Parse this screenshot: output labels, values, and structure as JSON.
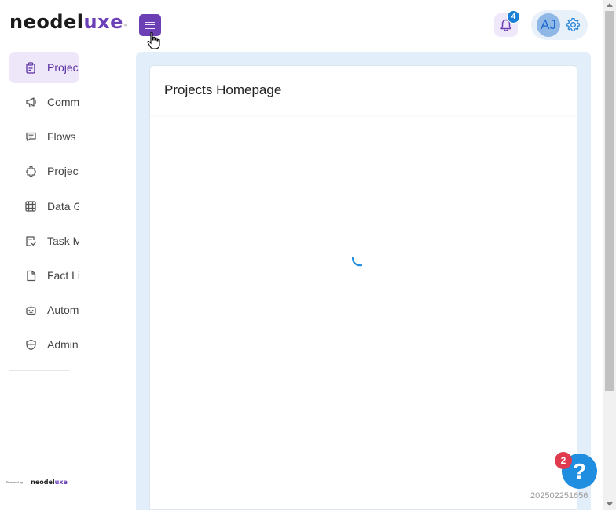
{
  "header": {
    "logo_main": "neodel",
    "logo_accent": "uxe",
    "logo_tm": "™",
    "notifications_count": "4",
    "avatar_initials": "AJ"
  },
  "sidebar": {
    "items": [
      {
        "label": "Projects",
        "icon": "clipboard-icon",
        "active": true
      },
      {
        "label": "Communications",
        "icon": "megaphone-icon"
      },
      {
        "label": "Flows",
        "icon": "chat-icon"
      },
      {
        "label": "Projects",
        "icon": "puzzle-icon"
      },
      {
        "label": "Data Grid",
        "icon": "grid-icon"
      },
      {
        "label": "Task Manager",
        "icon": "task-icon"
      },
      {
        "label": "Fact List",
        "icon": "file-icon"
      },
      {
        "label": "Automation",
        "icon": "robot-icon"
      },
      {
        "label": "Admin",
        "icon": "shield-icon"
      }
    ],
    "powered_by": "Powered by",
    "powered_logo_main": "neodel",
    "powered_logo_accent": "uxe"
  },
  "main": {
    "title": "Projects Homepage",
    "loading": true
  },
  "help": {
    "label": "?",
    "badge": "2"
  },
  "build_id": "202502251656",
  "colors": {
    "brand_purple": "#6d3fb4",
    "accent_blue": "#1f8de0",
    "badge_red": "#e03a4e",
    "main_bg": "#e2eef9"
  }
}
